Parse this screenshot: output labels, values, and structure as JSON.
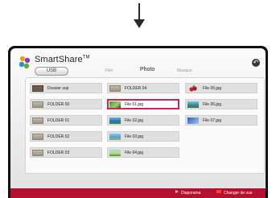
{
  "app": {
    "title": "SmartShare",
    "trademark": "TM",
    "colors": {
      "accent": "#c8254f",
      "footer": "#b5102f",
      "arrow": "#2a2a2a"
    }
  },
  "header": {
    "usb_label": "USB",
    "tabs": [
      {
        "label": "Film",
        "active": false
      },
      {
        "label": "Photo",
        "active": true
      },
      {
        "label": "Musique",
        "active": false
      }
    ],
    "back_icon": "back-arrow-icon"
  },
  "grid": {
    "columns": [
      [
        {
          "label": "Dossier sup",
          "icon": "folder-up-icon"
        },
        {
          "label": "FOLDER 00",
          "icon": "folder-icon"
        },
        {
          "label": "FOLDER 01",
          "icon": "folder-icon"
        },
        {
          "label": "FOLDER 02",
          "icon": "folder-icon"
        },
        {
          "label": "FOLDER 03",
          "icon": "folder-icon"
        }
      ],
      [
        {
          "label": "FOLDER 04",
          "icon": "folder-icon"
        },
        {
          "label": "File 01.jpg",
          "icon": "image-thumbnail-icon",
          "selected": true
        },
        {
          "label": "File 02.jpg",
          "icon": "image-thumbnail-icon"
        },
        {
          "label": "File 03.jpg",
          "icon": "image-thumbnail-icon"
        },
        {
          "label": "File 04.jpg",
          "icon": "image-thumbnail-icon"
        }
      ],
      [
        {
          "label": "File 05.jpg",
          "icon": "image-thumbnail-icon"
        },
        {
          "label": "File 06.jpg",
          "icon": "image-thumbnail-icon"
        },
        {
          "label": "File 07.jpg",
          "icon": "image-thumbnail-icon"
        }
      ]
    ]
  },
  "footer": {
    "slideshow_label": "Diaporama",
    "change_view_label": "Changer de vue"
  }
}
